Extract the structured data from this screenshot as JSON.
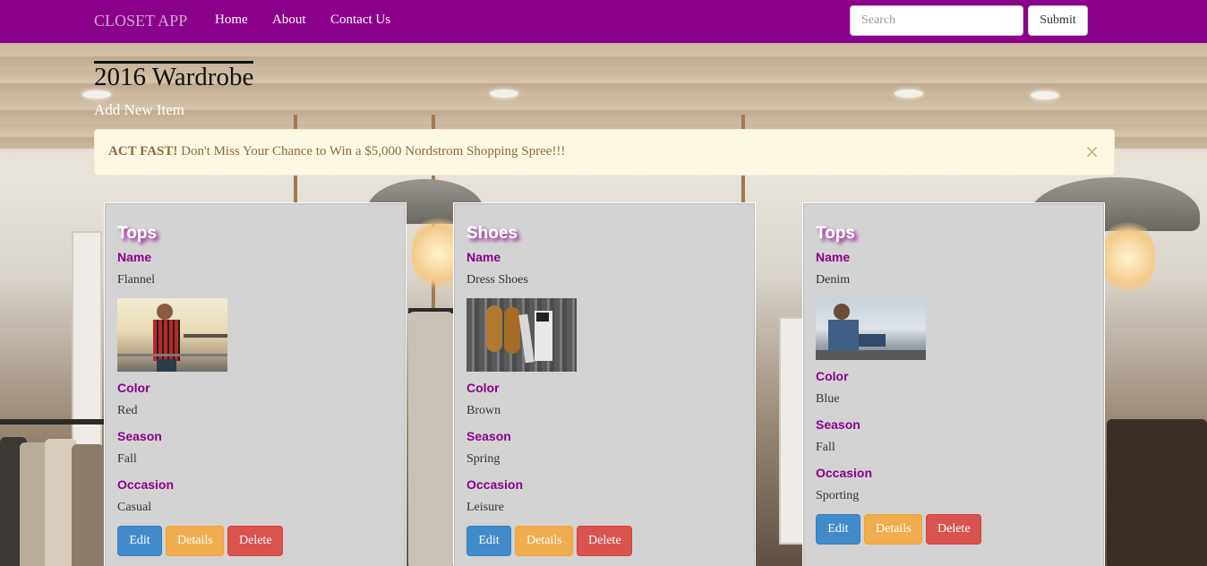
{
  "navbar": {
    "brand": "CLOSET APP",
    "links": [
      "Home",
      "About",
      "Contact Us"
    ],
    "search_placeholder": "Search",
    "submit_label": "Submit",
    "background_color": "#8b008b"
  },
  "header": {
    "title": "2016 Wardrobe",
    "add_link": "Add New Item"
  },
  "alert": {
    "bold_text": "ACT FAST!",
    "message": " Don't Miss Your Chance to Win a $5,000 Nordstrom Shopping Spree!!!",
    "close_icon": "×"
  },
  "labels": {
    "name": "Name",
    "color": "Color",
    "season": "Season",
    "occasion": "Occasion"
  },
  "buttons": {
    "edit": "Edit",
    "details": "Details",
    "delete": "Delete"
  },
  "items": [
    {
      "category": "Tops",
      "name": "Flannel",
      "color": "Red",
      "season": "Fall",
      "occasion": "Casual",
      "image_icon": "man-in-flannel-photo"
    },
    {
      "category": "Shoes",
      "name": "Dress Shoes",
      "color": "Brown",
      "season": "Spring",
      "occasion": "Leisure",
      "image_icon": "dress-shoes-photo"
    },
    {
      "category": "Tops",
      "name": "Denim",
      "color": "Blue",
      "season": "Fall",
      "occasion": "Sporting",
      "image_icon": "man-in-denim-photo"
    }
  ],
  "colors": {
    "label_accent": "#8b008b",
    "edit": "#428bca",
    "details": "#f0ad4e",
    "delete": "#d9534f",
    "card_bg": "#d3d3d3",
    "alert_bg": "#fcf8e3"
  }
}
